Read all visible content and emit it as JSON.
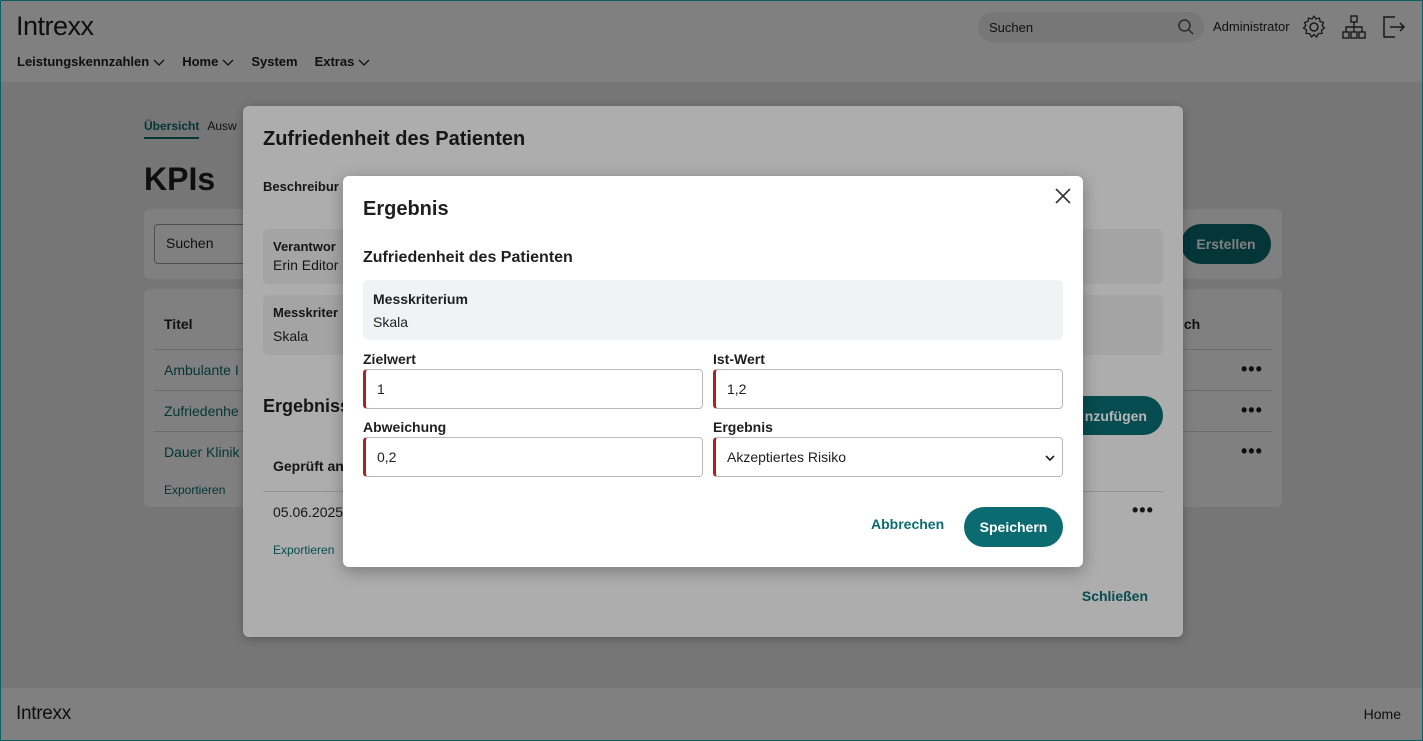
{
  "header": {
    "logo": "Intrexx",
    "nav": [
      {
        "label": "Leistungskennzahlen",
        "has_dropdown": true
      },
      {
        "label": "Home",
        "has_dropdown": true
      },
      {
        "label": "System",
        "has_dropdown": false
      },
      {
        "label": "Extras",
        "has_dropdown": true
      }
    ],
    "search_placeholder": "Suchen",
    "user": "Administrator",
    "icons": [
      "settings-icon",
      "sitemap-icon",
      "logout-icon"
    ]
  },
  "background_page": {
    "tabs": [
      "Übersicht",
      "Ausw"
    ],
    "title": "KPIs",
    "search_placeholder": "Suchen",
    "create_button": "Erstellen",
    "table": {
      "col_title": "Titel",
      "col_right": "rtlich",
      "rows": [
        "Ambulante I",
        "Zufriedenhe",
        "Dauer Klinik"
      ],
      "export_link": "Exportieren"
    }
  },
  "detail_dialog": {
    "title": "Zufriedenheit des Patienten",
    "description_label": "Beschreibur",
    "responsible": {
      "label": "Verantwor",
      "value": "Erin Editor"
    },
    "criterion": {
      "label": "Messkriter",
      "value": "Skala"
    },
    "results_section": "Ergebniss",
    "add_button": "nzufügen",
    "results_table": {
      "col_checked": "Geprüft an",
      "row_date": "05.06.2025"
    },
    "export_link": "Exportieren",
    "close_button": "Schließen"
  },
  "result_dialog": {
    "title": "Ergebnis",
    "subtitle": "Zufriedenheit des Patienten",
    "criterion_label": "Messkriterium",
    "criterion_value": "Skala",
    "target_label": "Zielwert",
    "target_value": "1",
    "actual_label": "Ist-Wert",
    "actual_value": "1,2",
    "deviation_label": "Abweichung",
    "deviation_value": "0,2",
    "result_label": "Ergebnis",
    "result_value": "Akzeptiertes Risiko",
    "cancel_button": "Abbrechen",
    "save_button": "Speichern"
  },
  "footer": {
    "logo": "Intrexx",
    "home_link": "Home"
  },
  "colors": {
    "accent": "#0b6b71",
    "required_marker": "#a82424"
  }
}
